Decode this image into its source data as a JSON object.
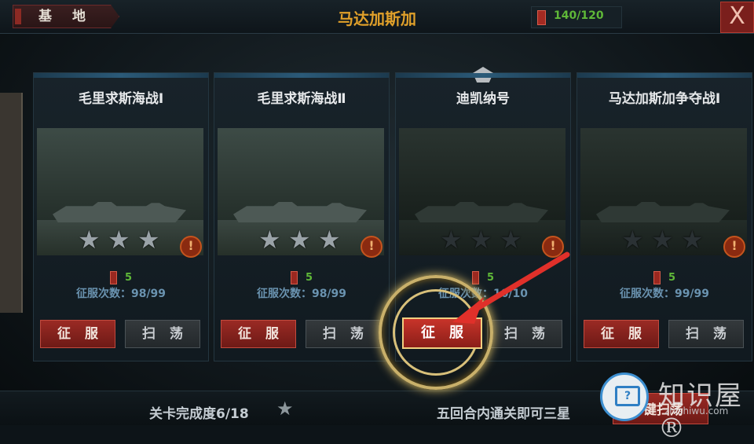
{
  "header": {
    "base_label": "基 地",
    "title": "马达加斯加",
    "energy": "140/120",
    "close_label": "X"
  },
  "cards": [
    {
      "title": "毛里求斯海战Ⅰ",
      "cost": "5",
      "conquer_count": "征服次数：98/99",
      "stars_earned": 3,
      "conquer_label": "征服",
      "sweep_label": "扫荡"
    },
    {
      "title": "毛里求斯海战Ⅱ",
      "cost": "5",
      "conquer_count": "征服次数：98/99",
      "stars_earned": 3,
      "conquer_label": "征服",
      "sweep_label": "扫荡"
    },
    {
      "title": "迪凯纳号",
      "cost": "5",
      "conquer_count": "征服次数：10/10",
      "stars_earned": 0,
      "conquer_label": "征服",
      "sweep_label": "扫荡"
    },
    {
      "title": "马达加斯加争夺战Ⅰ",
      "cost": "5",
      "conquer_count": "征服次数：99/99",
      "stars_earned": 0,
      "conquer_label": "征服",
      "sweep_label": "扫荡"
    }
  ],
  "footer": {
    "progress": "关卡完成度6/18",
    "hint": "五回合内通关即可三星",
    "sweep_all": "键扫荡"
  },
  "overlay": {
    "focus_button": "征服",
    "watermark": "知识屋®",
    "watermark_sub": "zhishiwu.com"
  },
  "colors": {
    "accent_title": "#e0a02a",
    "energy_green": "#5fb838",
    "conquer_red": "#9a2a24",
    "arrow_red": "#e0302a"
  }
}
